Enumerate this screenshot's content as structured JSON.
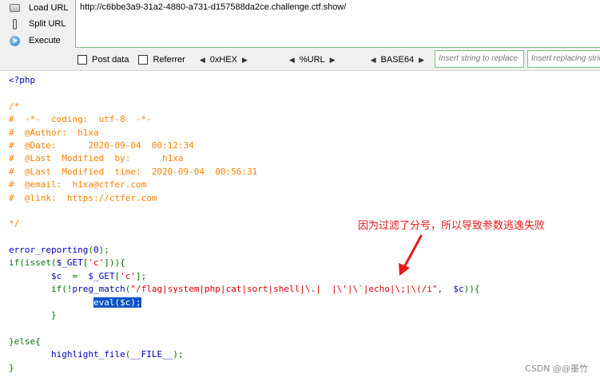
{
  "toolbar": {
    "load_url": "Load URL",
    "split_url": "Split URL",
    "execute": "Execute",
    "url_value": "http://c6bbe3a9-31a2-4880-a731-d157588da2ce.challenge.ctf.show/",
    "post_data": "Post data",
    "referrer": "Referrer",
    "hex": "0xHEX",
    "url_enc": "%URL",
    "base64": "BASE64",
    "insert_placeholder": "Insert string to replace",
    "replacing_placeholder": "Insert replacing string"
  },
  "code": {
    "l1": "<?php",
    "l3": "/*",
    "l4": "#  -*-  coding:  utf-8  -*-",
    "l5": "#  @Author:  h1xa",
    "l6": "#  @Date:      2020-09-04  00:12:34",
    "l7": "#  @Last  Modified  by:      h1xa",
    "l8": "#  @Last  Modified  time:  2020-09-04  00:56:31",
    "l9": "#  @email:  h1xa@ctfer.com",
    "l10": "#  @link:  https://ctfer.com",
    "l12": "*/",
    "l14_fn": "error_reporting",
    "l14_p1": "(",
    "l14_num": "0",
    "l14_p2": ");",
    "l15_if": "if(isset(",
    "l15_var": "$_GET",
    "l15_b1": "[",
    "l15_str": "'c'",
    "l15_b2": "])){",
    "l16_ind": "        ",
    "l16_c": "$c",
    "l16_eq": "  =  ",
    "l16_get": "$_GET",
    "l16_b1": "[",
    "l16_str": "'c'",
    "l16_b2": "];",
    "l17_ind": "        ",
    "l17_if": "if(!",
    "l17_fn": "preg_match",
    "l17_p": "(",
    "l17_pat": "\"/flag|system|php|cat|sort|shell|\\.|  |\\'|\\`|echo|\\;|\\(/i\"",
    "l17_comma": ",  ",
    "l17_c": "$c",
    "l17_end": ")){",
    "l18_ind": "                ",
    "l18_eval": "eval(",
    "l18_c": "$c",
    "l18_end": ");",
    "l19": "        }",
    "l21": "}else{",
    "l22_ind": "        ",
    "l22_fn": "highlight_file",
    "l22_p": "(",
    "l22_const": "__FILE__",
    "l22_end": ");",
    "l23": "}"
  },
  "annotation": "因为过滤了分号，所以导致参数逃逸失败",
  "watermark": "CSDN @@墨竹",
  "colors": {
    "keyword": "#007700",
    "string": "#dd0000",
    "default": "#0000bb",
    "comment": "#ff8000",
    "annotation": "#e61919",
    "selection": "#0a54c8"
  }
}
